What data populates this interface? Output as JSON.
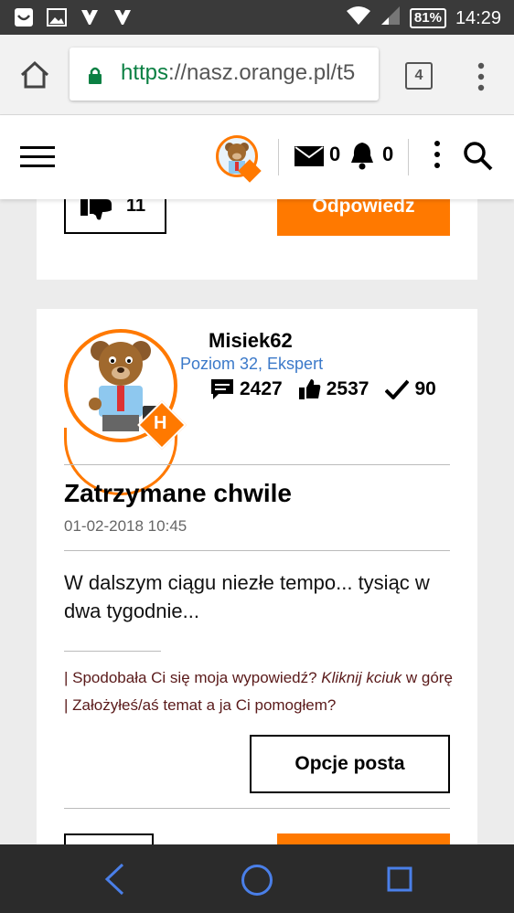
{
  "status_bar": {
    "battery": "81%",
    "time": "14:29"
  },
  "browser": {
    "url_scheme": "https",
    "url_rest": "://nasz.orange.pl/t5",
    "tab_count": "4"
  },
  "header": {
    "messages_count": "0",
    "notifications_count": "0"
  },
  "previous_post": {
    "likes": "11",
    "reply_label": "Odpowiedz"
  },
  "post": {
    "author": "Misiek62",
    "rank": "Poziom 32, Ekspert",
    "rank_badge": "H",
    "stats": {
      "posts": "2427",
      "kudos": "2537",
      "solutions": "90"
    },
    "title": "Zatrzymane chwile",
    "date": "01-02-2018 10:45",
    "body": "W dalszym ciągu niezłe tempo... tysiąc w dwa tygodnie...",
    "signature": {
      "part1": "| Spodobała Ci się moja wypowiedź? ",
      "part2": "Kliknij kciuk",
      "part3": " w górę | Założyłeś/aś temat a ja Ci pomogłem?"
    },
    "options_label": "Opcje posta"
  },
  "colors": {
    "accent": "#ff7900",
    "rank_text": "#3b79c9",
    "url_green": "#0b8043"
  }
}
